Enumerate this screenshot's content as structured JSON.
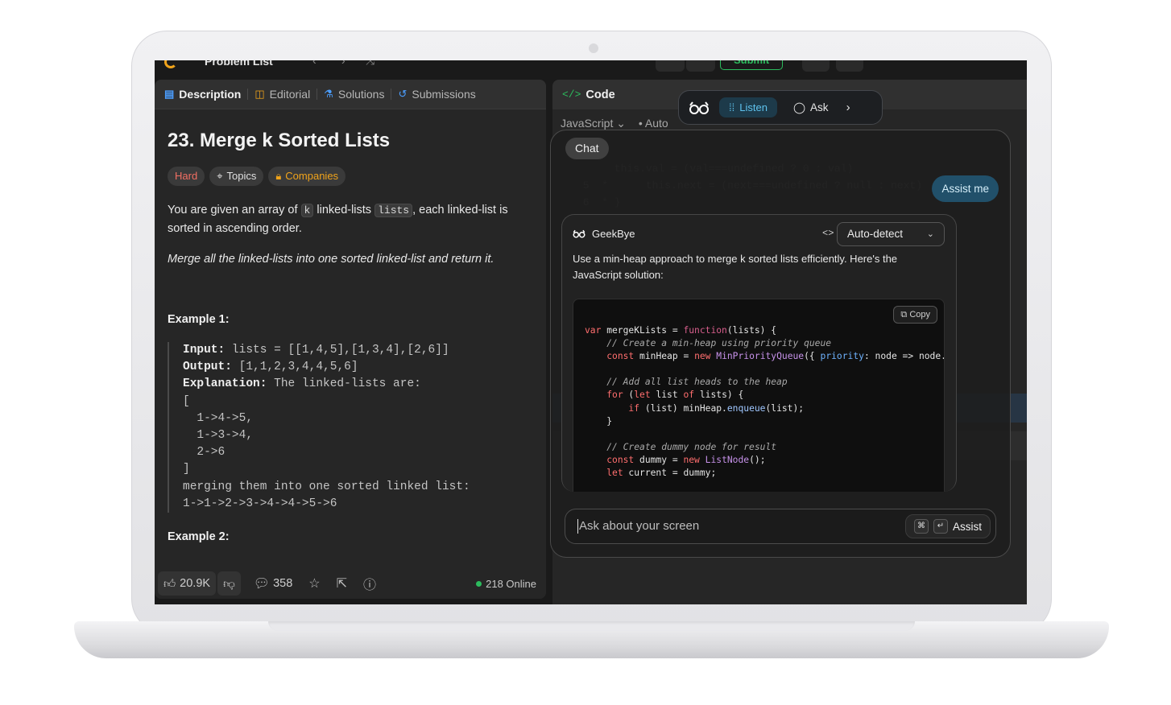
{
  "topbar": {
    "problem_list": "Problem List",
    "submit": "Submit"
  },
  "tabs": [
    {
      "label": "Description",
      "icon": "description-icon"
    },
    {
      "label": "Editorial",
      "icon": "book-icon"
    },
    {
      "label": "Solutions",
      "icon": "flask-icon"
    },
    {
      "label": "Submissions",
      "icon": "history-icon"
    }
  ],
  "problem": {
    "title": "23. Merge k Sorted Lists",
    "difficulty": "Hard",
    "topics": "Topics",
    "companies": "Companies",
    "desc_1": "You are given an array of ",
    "desc_k": "k",
    "desc_2": " linked-lists ",
    "desc_lists": "lists",
    "desc_3": ", each linked-list is sorted in ascending order.",
    "desc_italic": "Merge all the linked-lists into one sorted linked-list and return it.",
    "example1": "Example 1:",
    "example2": "Example 2:",
    "ex1_input_label": "Input:",
    "ex1_input": " lists = [[1,4,5],[1,3,4],[2,6]]",
    "ex1_output_label": "Output:",
    "ex1_output": " [1,1,2,3,4,4,5,6]",
    "ex1_expl_label": "Explanation:",
    "ex1_expl": " The linked-lists are:",
    "ex1_body": "[\n  1->4->5,\n  1->3->4,\n  2->6\n]\nmerging them into one sorted linked list:\n1->1->2->3->4->4->5->6"
  },
  "footer": {
    "likes": "20.9K",
    "comments": "358",
    "online": "218 Online"
  },
  "code_panel": {
    "title": "Code",
    "language": "JavaScript",
    "mode": "Auto"
  },
  "toolbar": {
    "listen": "Listen",
    "ask": "Ask"
  },
  "overlay": {
    "chat_tab": "Chat",
    "assist_me": "Assist me",
    "agent_name": "GeekBye",
    "language_select": "Auto-detect",
    "answer": "Use a min-heap approach to merge k sorted lists efficiently. Here's the JavaScript solution:",
    "copy": "Copy",
    "ask_placeholder": "Ask about your screen",
    "assist_button": "Assist",
    "kbd_cmd": "⌘",
    "kbd_enter": "↵"
  },
  "colors": {
    "accent_green": "#2cbb5d",
    "accent_orange": "#f0a31a",
    "listen_blue": "#5fc3ee",
    "hard_red": "#f36f63"
  }
}
